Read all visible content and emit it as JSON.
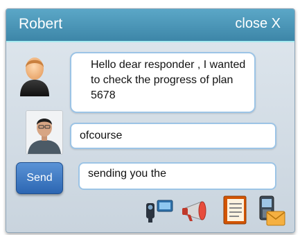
{
  "window": {
    "contact_name": "Robert",
    "close_label": "close X"
  },
  "messages": [
    {
      "sender": "other",
      "text": "Hello  dear responder , I wanted to check the progress of plan 5678"
    },
    {
      "sender": "self",
      "text": "ofcourse"
    }
  ],
  "composer": {
    "send_label": "Send",
    "draft_text": "sending you the"
  },
  "toolbar_icons": [
    "video-camera-icon",
    "megaphone-icon",
    "notebook-icon",
    "phone-mail-icon"
  ],
  "colors": {
    "titlebar": "#4a96b8",
    "send_button": "#3f7ccc",
    "bubble_border": "#9cc4e6"
  }
}
